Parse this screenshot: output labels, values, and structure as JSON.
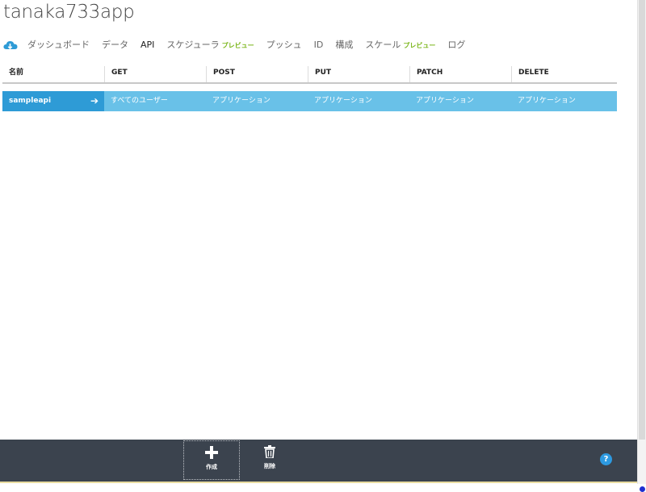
{
  "app": {
    "title": "tanaka733app"
  },
  "nav": {
    "items": [
      {
        "label": "ダッシュボード",
        "badge": ""
      },
      {
        "label": "データ",
        "badge": ""
      },
      {
        "label": "API",
        "badge": ""
      },
      {
        "label": "スケジューラ",
        "badge": "プレビュー"
      },
      {
        "label": "プッシュ",
        "badge": ""
      },
      {
        "label": "ID",
        "badge": ""
      },
      {
        "label": "構成",
        "badge": ""
      },
      {
        "label": "スケール",
        "badge": "プレビュー"
      },
      {
        "label": "ログ",
        "badge": ""
      }
    ],
    "active": "API"
  },
  "table": {
    "headers": [
      "名前",
      "GET",
      "POST",
      "PUT",
      "PATCH",
      "DELETE"
    ],
    "rows": [
      {
        "name": "sampleapi",
        "get": "すべてのユーザー",
        "post": "アプリケーション",
        "put": "アプリケーション",
        "patch": "アプリケーション",
        "delete": "アプリケーション"
      }
    ]
  },
  "commandbar": {
    "create_label": "作成",
    "delete_label": "削除",
    "help_label": "?"
  },
  "colors": {
    "accent": "#2e9bd6",
    "row_highlight": "#69c1e8",
    "badge": "#7bb61b",
    "commandbar": "#3b434e"
  },
  "icons": [
    "cloud-icon",
    "arrow-right-icon",
    "plus-icon",
    "trash-icon",
    "help-icon"
  ]
}
